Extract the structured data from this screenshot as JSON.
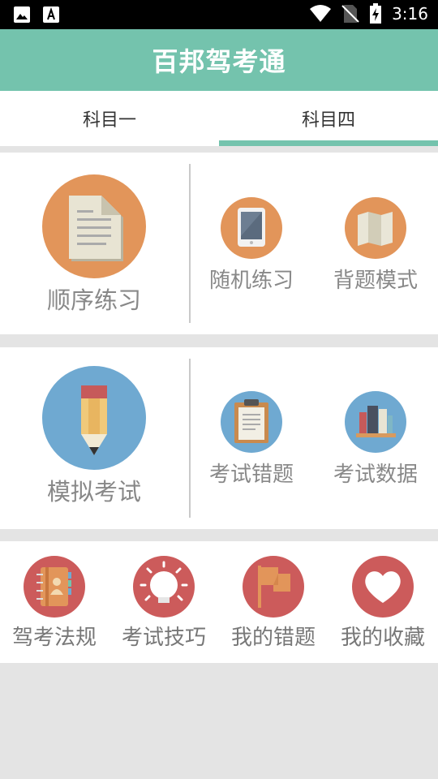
{
  "status_bar": {
    "time": "3:16",
    "icons": [
      "image-icon",
      "font-download-icon",
      "wifi-icon",
      "no-sim-icon",
      "battery-charging-icon"
    ]
  },
  "app_bar": {
    "title": "百邦驾考通"
  },
  "tabs": [
    {
      "label": "科目一",
      "selected": false
    },
    {
      "label": "科目四",
      "selected": true
    }
  ],
  "section1": {
    "big": {
      "label": "顺序练习",
      "icon": "document-icon"
    },
    "items": [
      {
        "label": "随机练习",
        "icon": "tablet-icon"
      },
      {
        "label": "背题模式",
        "icon": "map-icon"
      }
    ]
  },
  "section2": {
    "big": {
      "label": "模拟考试",
      "icon": "pencil-icon"
    },
    "items": [
      {
        "label": "考试错题",
        "icon": "clipboard-icon"
      },
      {
        "label": "考试数据",
        "icon": "books-icon"
      }
    ]
  },
  "bottom_items": [
    {
      "label": "驾考法规",
      "icon": "contact-book-icon"
    },
    {
      "label": "考试技巧",
      "icon": "lightbulb-icon"
    },
    {
      "label": "我的错题",
      "icon": "flag-icon"
    },
    {
      "label": "我的收藏",
      "icon": "heart-icon"
    }
  ],
  "colors": {
    "accent": "#74c3ad",
    "orange": "#e2955a",
    "blue": "#6fa9d1",
    "red": "#cc5b5b",
    "background": "#e4e4e4"
  }
}
